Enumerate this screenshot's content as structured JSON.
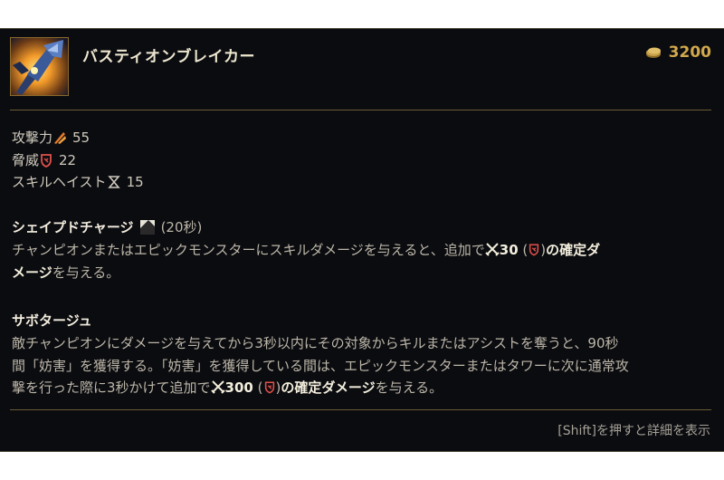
{
  "item": {
    "name": "バスティオンブレイカー",
    "icon": "bastionbreaker-item-icon",
    "cost": "3200",
    "cost_icon": "gold-coins-icon"
  },
  "stats": [
    {
      "label": "攻撃力",
      "icon": "attack-damage-icon",
      "value": "55"
    },
    {
      "label": "脅威",
      "icon": "lethality-icon",
      "value": "22"
    },
    {
      "label": "スキルヘイスト",
      "icon": "ability-haste-icon",
      "value": "15"
    }
  ],
  "passive1": {
    "name": "シェイプドチャージ",
    "icon": "shaped-charge-icon",
    "cooldown": "(20秒)",
    "desc_a": "チャンピオンまたはエピックモンスターにスキルダメージを与えると、追加で",
    "dmg": "30",
    "dmg_paren_open": "(",
    "dmg_paren_close": ")",
    "dmg_type": "の確定ダ",
    "desc_b1": "メージ",
    "desc_b2": "を与える。"
  },
  "passive2": {
    "name": "サボタージュ",
    "line1": "敵チャンピオンにダメージを与えてから3秒以内にその対象からキルまたはアシストを奪うと、90秒",
    "line2": "間「妨害」を獲得する。「妨害」を獲得している間は、エピックモンスターまたはタワーに次に通常攻",
    "line3_a": "撃を行った際に3秒かけて追加で",
    "dmg": "300",
    "dmg_paren_open": "(",
    "dmg_paren_close": ")",
    "dmg_type": "の確定ダメージ",
    "line3_b": "を与える。"
  },
  "footer": {
    "hint": "[Shift]を押すと詳細を表示"
  },
  "colors": {
    "background": "#0b0c10",
    "gold": "#d1a84b",
    "divider": "#6b5b35",
    "lethality_red": "#e0504a"
  }
}
